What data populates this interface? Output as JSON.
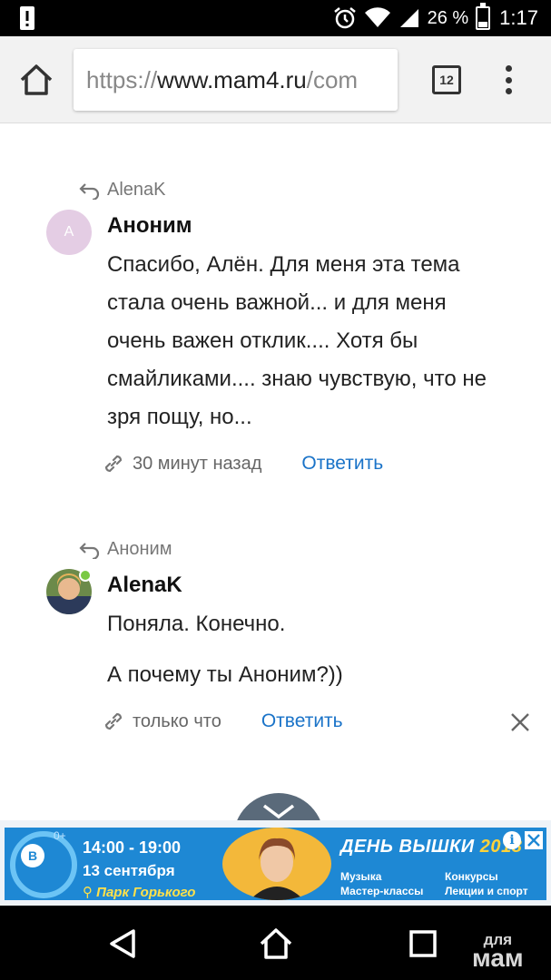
{
  "status_bar": {
    "battery_percent": "26 %",
    "battery_level": 0.26,
    "time": "1:17",
    "icons": [
      "alert-icon",
      "alarm-icon",
      "wifi-icon",
      "signal-icon",
      "battery-icon"
    ]
  },
  "browser": {
    "url_scheme": "https://",
    "url_domain": "www.mam4.ru",
    "url_path": "/com",
    "tab_count": "12"
  },
  "comments": [
    {
      "reply_to": "AlenaK",
      "avatar_letter": "A",
      "author": "Аноним",
      "lines": [
        "Спасибо, Алён. Для меня эта тема",
        "стала очень важной... и для меня",
        "очень важен отклик.... Хотя бы",
        "смайликами.... знаю чувствую, что не",
        "зря пощу, но..."
      ],
      "time": "30 минут назад",
      "reply_label": "Ответить"
    },
    {
      "reply_to": "Аноним",
      "author": "AlenaK",
      "online": true,
      "paragraphs": [
        "Поняла. Конечно.",
        "А почему ты Аноним?))"
      ],
      "time": "только что",
      "reply_label": "Ответить"
    }
  ],
  "ad": {
    "age_rating": "0+",
    "time_range": "14:00 - 19:00",
    "date": "13 сентября",
    "place": "Парк Горького",
    "title": "ДЕНЬ ВЫШКИ",
    "year": "2018",
    "tags": [
      "Музыка",
      "Конкурсы",
      "Мастер-классы",
      "Лекции и спорт"
    ]
  },
  "watermark": {
    "line1": "для",
    "line2": "мам"
  },
  "colors": {
    "accent_link": "#1a73c8",
    "online": "#7ac943",
    "ad_blue": "#1e88d4"
  }
}
